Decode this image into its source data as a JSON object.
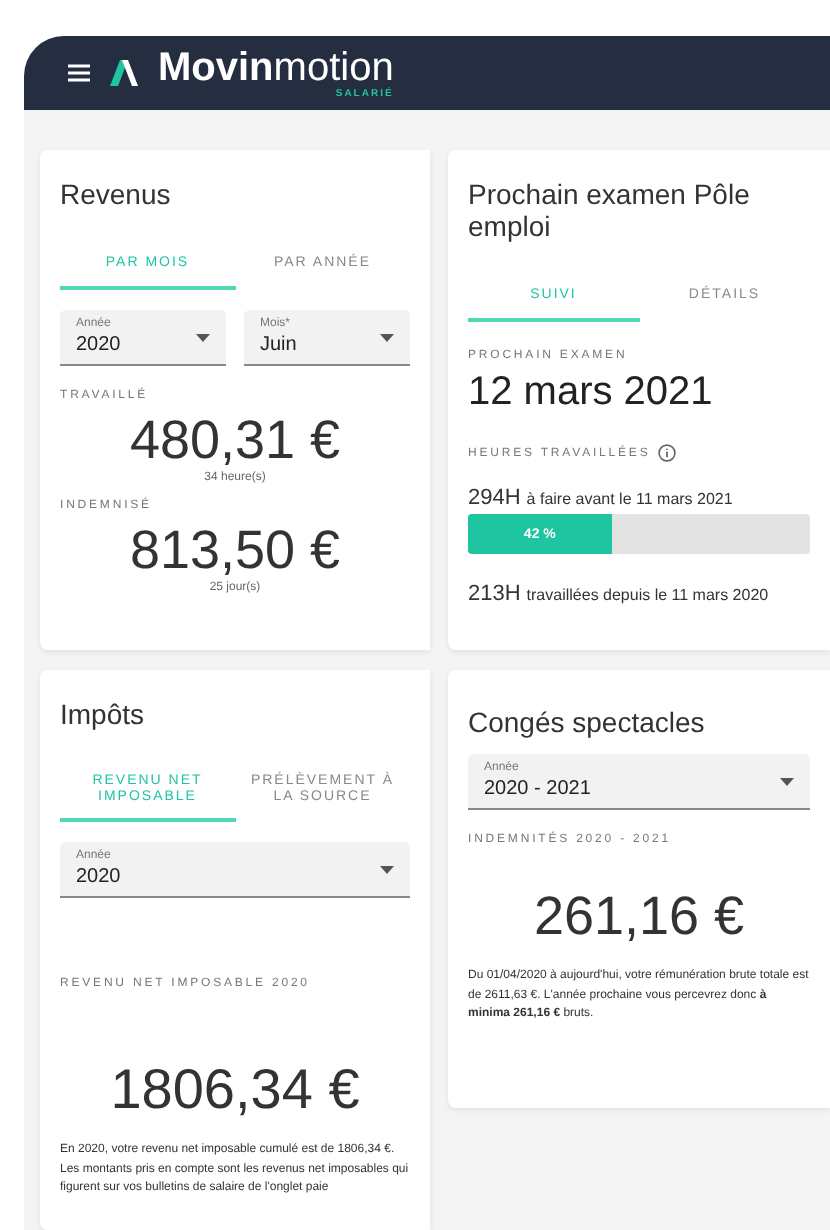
{
  "header": {
    "brand_bold": "Movin",
    "brand_light": "motion",
    "brand_sub": "SALARIÉ"
  },
  "revenus": {
    "title": "Revenus",
    "tabs": [
      {
        "label": "PAR MOIS",
        "selected": true
      },
      {
        "label": "PAR ANNÉE",
        "selected": false
      }
    ],
    "selects": [
      {
        "label": "Année",
        "value": "2020"
      },
      {
        "label": "Mois*",
        "value": "Juin"
      }
    ],
    "blocks": [
      {
        "label": "TRAVAILLÉ",
        "amount": "480,31 €",
        "unit": "34 heure(s)"
      },
      {
        "label": "INDEMNISÉ",
        "amount": "813,50 €",
        "unit": "25 jour(s)"
      }
    ]
  },
  "examen": {
    "title": "Prochain examen Pôle emploi",
    "tabs": [
      {
        "label": "SUIVI",
        "selected": true
      },
      {
        "label": "DÉTAILS",
        "selected": false
      }
    ],
    "next_label": "PROCHAIN EXAMEN",
    "next_date": "12 mars 2021",
    "hours_label": "HEURES TRAVAILLÉES",
    "todo": {
      "hours": "294H",
      "text": "à faire avant le 11 mars 2021"
    },
    "progress": {
      "level": 0.42,
      "reading": "42 %"
    },
    "done": {
      "hours": "213H",
      "text": "travaillées depuis le 11 mars 2020"
    }
  },
  "impots": {
    "title": "Impôts",
    "tabs": [
      {
        "label": "REVENU NET IMPOSABLE",
        "selected": true
      },
      {
        "label": "PRÉLÈVEMENT À LA SOURCE",
        "selected": false
      }
    ],
    "select": {
      "label": "Année",
      "value": "2020"
    },
    "amount_label": "REVENU NET IMPOSABLE 2020",
    "amount": "1806,34 €",
    "note": "En 2020, votre revenu net imposable cumulé est de 1806,34 €. Les montants pris en compte sont les revenus net imposables qui figurent sur vos bulletins de salaire de l'onglet paie"
  },
  "conges": {
    "title": "Congés spectacles",
    "select": {
      "label": "Année",
      "value": "2020 - 2021"
    },
    "amount_label": "INDEMNITÉS 2020 - 2021",
    "amount": "261,16 €",
    "note": "Du 01/04/2020 à aujourd'hui, votre rémunération brute totale est de 2611,63 €. L'année prochaine vous percevrez donc **à minima 261,16 €** bruts."
  }
}
